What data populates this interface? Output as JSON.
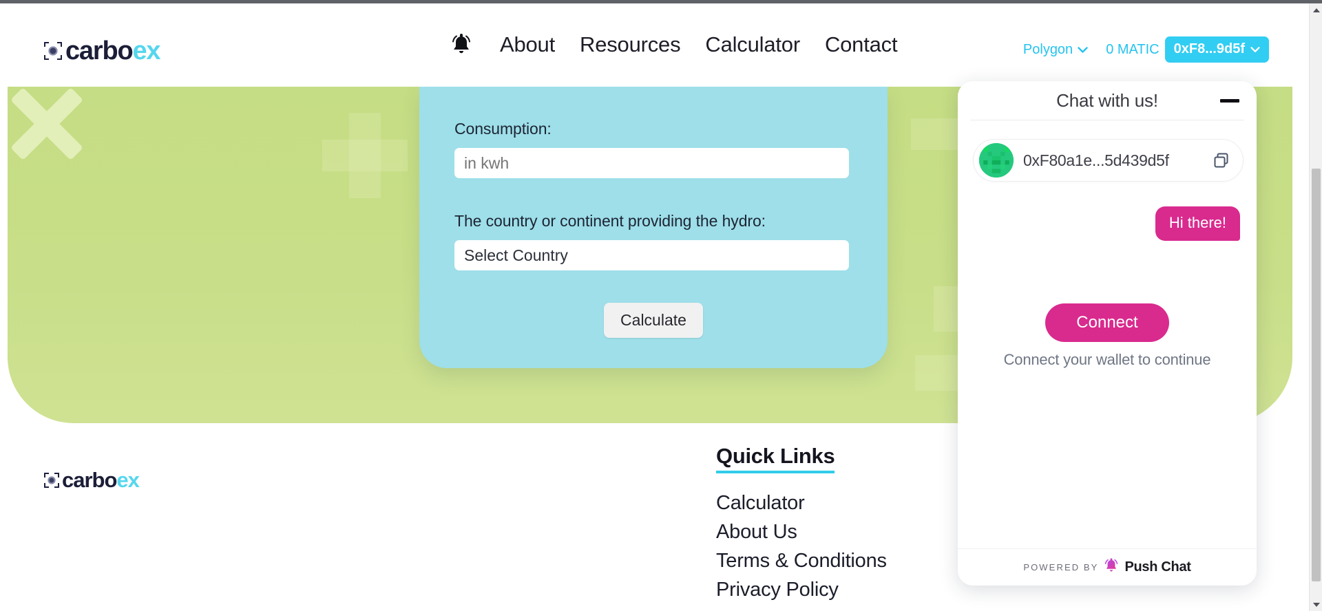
{
  "header": {
    "logo": {
      "name_dark": "carbo",
      "name_accent": "ex",
      "icon": "carboex-logo-mark"
    },
    "bell_icon": "bell-icon",
    "nav": [
      {
        "label": "About"
      },
      {
        "label": "Resources"
      },
      {
        "label": "Calculator"
      },
      {
        "label": "Contact"
      }
    ],
    "wallet": {
      "network": "Polygon",
      "network_chevron": "∨",
      "balance": "0 MATIC",
      "address_short": "0xF8...9d5f",
      "address_chevron": "∨"
    }
  },
  "calculator": {
    "consumption_label": "Consumption:",
    "consumption_placeholder": "in kwh",
    "consumption_value": "",
    "country_label": "The country or continent providing the hydro:",
    "country_value": "Select Country",
    "calculate_label": "Calculate"
  },
  "footer": {
    "logo": {
      "name_dark": "carbo",
      "name_accent": "ex"
    },
    "quick_links_title": "Quick Links",
    "quick_links": [
      {
        "label": "Calculator"
      },
      {
        "label": "About Us"
      },
      {
        "label": "Terms & Conditions"
      },
      {
        "label": "Privacy Policy"
      }
    ]
  },
  "chat": {
    "title": "Chat with us!",
    "minimize_label": "—",
    "wallet_address": "0xF80a1e...5d439d5f",
    "copy_icon": "copy-icon",
    "avatar_icon": "identicon-avatar",
    "messages": [
      {
        "text": "Hi there!",
        "side": "right"
      }
    ],
    "connect_label": "Connect",
    "connect_hint": "Connect your wallet to continue",
    "powered_by_label": "POWERED BY",
    "powered_by_name": "Push Chat",
    "powered_by_icon": "push-bell-icon"
  },
  "colors": {
    "accent_cyan": "#32cdf2",
    "hero_green": "#c8de88",
    "card_blue": "#9edfe9",
    "chat_pink": "#d92a8e",
    "logo_cyan": "#55d7ee"
  },
  "scrollbar": {
    "up_arrow": "scroll-up-arrow",
    "down_arrow": "scroll-down-arrow"
  }
}
